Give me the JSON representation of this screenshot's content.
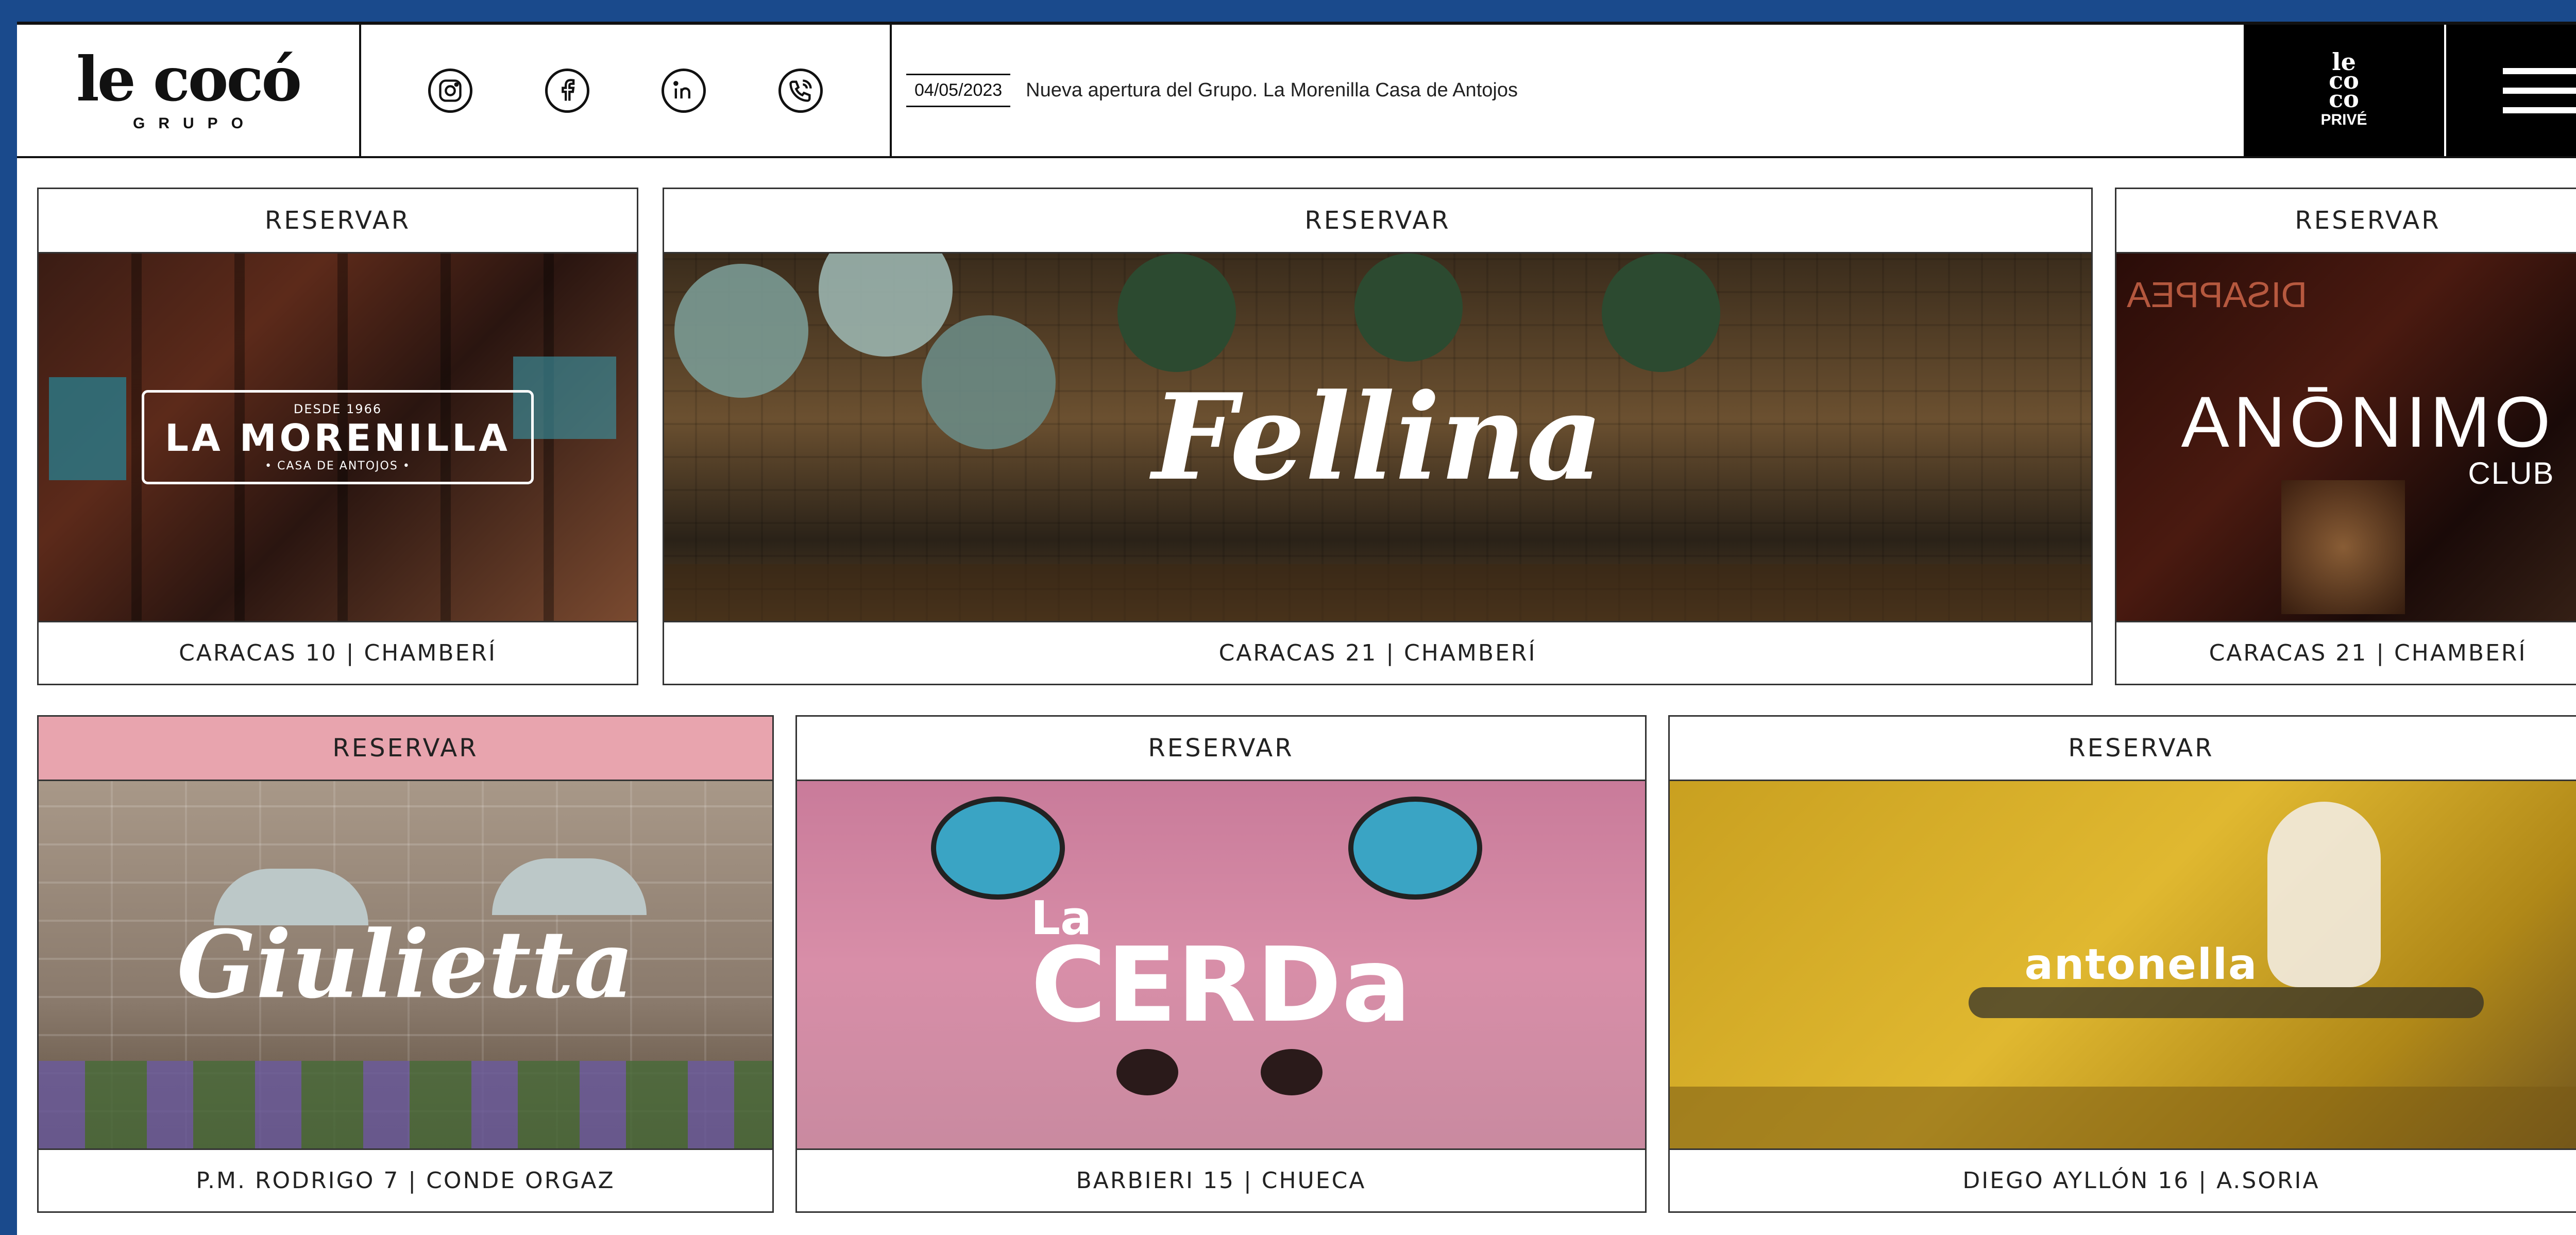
{
  "header": {
    "logo_main": "le cocó",
    "logo_sub": "GRUPO",
    "social": [
      {
        "icon": "instagram-icon"
      },
      {
        "icon": "facebook-icon"
      },
      {
        "icon": "linkedin-icon"
      },
      {
        "icon": "phone-icon"
      }
    ],
    "news_date": "04/05/2023",
    "news_text": "Nueva apertura del Grupo. La Morenilla Casa de Antojos",
    "prive_stack": "le\nco\nco",
    "prive_label": "PRIVÉ",
    "menu_icon": "hamburger-menu-icon"
  },
  "cards": [
    {
      "button": "RESERVAR",
      "brand": "LA MORENILLA",
      "brand_top": "DESDE 1966",
      "brand_bottom": "• CASA DE ANTOJOS •",
      "address": "CARACAS 10 | CHAMBERÍ"
    },
    {
      "button": "RESERVAR",
      "brand": "Fellina",
      "address": "CARACAS 21 | CHAMBERÍ"
    },
    {
      "button": "RESERVAR",
      "brand": "ANŌNIMO",
      "brand_sub": "CLUB",
      "address": "CARACAS 21 | CHAMBERÍ"
    },
    {
      "button": "RESERVAR",
      "brand": "Giulietta",
      "address": "P.M. RODRIGO 7 | CONDE ORGAZ"
    },
    {
      "button": "RESERVAR",
      "brand": "CERDa",
      "brand_top": "La",
      "address": "BARBIERI 15 | CHUECA"
    },
    {
      "button": "RESERVAR",
      "brand": "antonella",
      "address": "DIEGO AYLLÓN 16 | A.SORIA"
    }
  ],
  "colors": {
    "frame": "#1a4a8c",
    "reserve_pink": "#e8a4ae"
  }
}
